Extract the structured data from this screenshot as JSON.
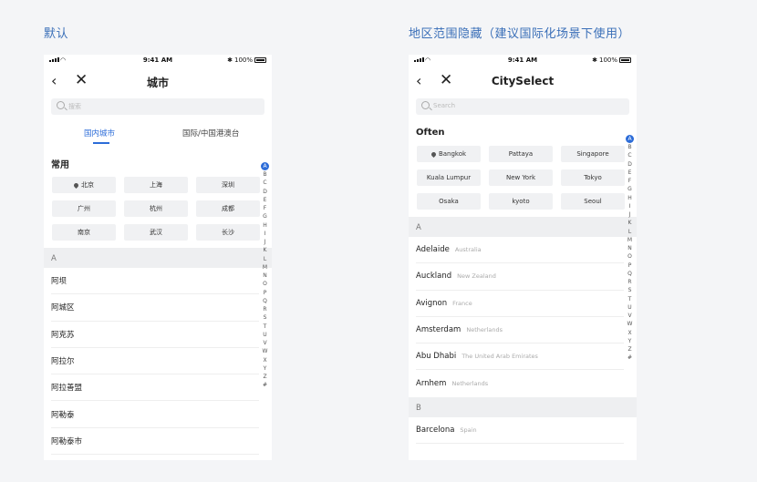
{
  "left": {
    "section_title": "默认",
    "status": {
      "time": "9:41 AM",
      "battery": "100%"
    },
    "nav": {
      "title": "城市"
    },
    "search": {
      "placeholder": "搜索"
    },
    "tabs": [
      {
        "label": "国内城市",
        "active": true
      },
      {
        "label": "国际/中国港澳台",
        "active": false
      }
    ],
    "common": {
      "title": "常用",
      "cities": [
        "北京",
        "上海",
        "深圳",
        "广州",
        "杭州",
        "成都",
        "南京",
        "武汉",
        "长沙"
      ],
      "current_location": "北京"
    },
    "letter": "A",
    "list": [
      "阿坝",
      "阿城区",
      "阿克苏",
      "阿拉尔",
      "阿拉善盟",
      "阿勒泰",
      "阿勒泰市"
    ]
  },
  "right": {
    "section_title": "地区范围隐藏（建议国际化场景下使用）",
    "status": {
      "time": "9:41 AM",
      "battery": "100%"
    },
    "nav": {
      "title": "CitySelect"
    },
    "search": {
      "placeholder": "Search"
    },
    "often": {
      "title": "Often",
      "cities": [
        "Bangkok",
        "Pattaya",
        "Singapore",
        "Kuala Lumpur",
        "New York",
        "Tokyo",
        "Osaka",
        "kyoto",
        "Seoul"
      ],
      "current_location": "Bangkok"
    },
    "letter_a": "A",
    "list": [
      {
        "name": "Adelaide",
        "country": "Australia"
      },
      {
        "name": "Auckland",
        "country": "New Zealand"
      },
      {
        "name": "Avignon",
        "country": "France"
      },
      {
        "name": "Amsterdam",
        "country": "Netherlands"
      },
      {
        "name": "Abu Dhabi",
        "country": "The United Arab Emirates"
      },
      {
        "name": "Arnhem",
        "country": "Netherlands"
      }
    ],
    "letter_b": "B",
    "list_b": [
      {
        "name": "Barcelona",
        "country": "Spain"
      }
    ]
  },
  "index_letters": [
    "A",
    "B",
    "C",
    "D",
    "E",
    "F",
    "G",
    "H",
    "I",
    "J",
    "K",
    "L",
    "M",
    "N",
    "O",
    "P",
    "Q",
    "R",
    "S",
    "T",
    "U",
    "V",
    "W",
    "X",
    "Y",
    "Z",
    "#"
  ],
  "colors": {
    "accent": "#2c6cd8",
    "section_title": "#3a6fb8"
  }
}
